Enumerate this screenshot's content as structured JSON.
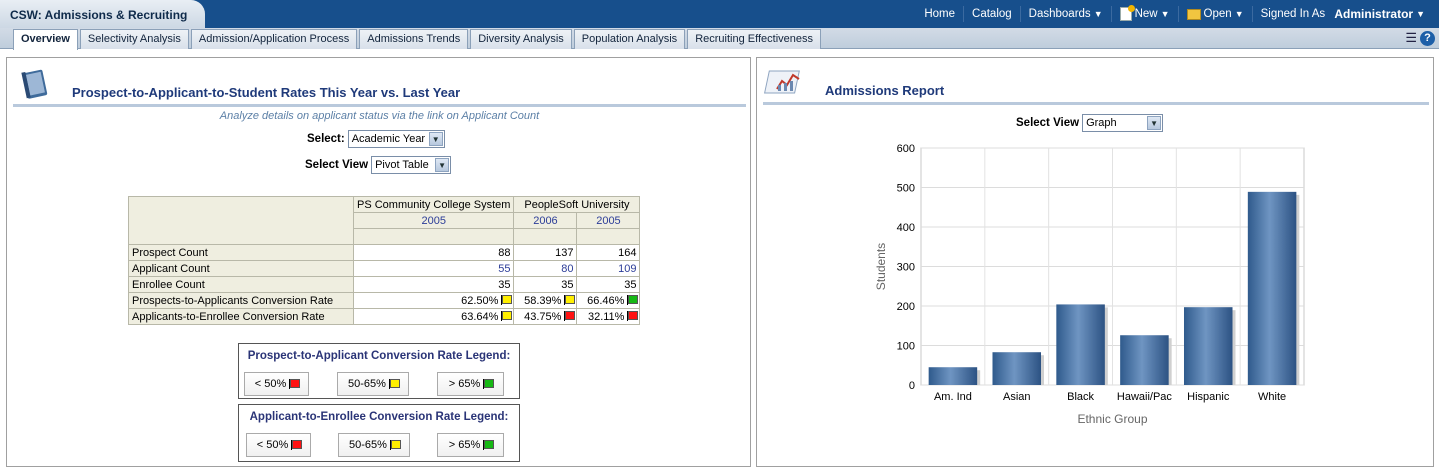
{
  "app_title": "CSW: Admissions & Recruiting",
  "topnav": {
    "home": "Home",
    "catalog": "Catalog",
    "dashboards": "Dashboards",
    "new": "New",
    "open": "Open",
    "signed_in_as": "Signed In As",
    "user": "Administrator"
  },
  "tabs": [
    {
      "label": "Overview",
      "active": true
    },
    {
      "label": "Selectivity Analysis"
    },
    {
      "label": "Admission/Application Process"
    },
    {
      "label": "Admissions Trends"
    },
    {
      "label": "Diversity Analysis"
    },
    {
      "label": "Population Analysis"
    },
    {
      "label": "Recruiting Effectiveness"
    }
  ],
  "left": {
    "title": "Prospect-to-Applicant-to-Student Rates This Year vs. Last Year",
    "note": "Analyze details on applicant status via the link on Applicant Count",
    "select_label": "Select:",
    "select_value": "Academic Year",
    "view_label": "Select View",
    "view_value": "Pivot Table",
    "table": {
      "col_groups": [
        "PS Community College System",
        "PeopleSoft University"
      ],
      "years": [
        "2005",
        "2006",
        "2005"
      ],
      "rows": [
        {
          "label": "Prospect Count",
          "values": [
            "88",
            "137",
            "164"
          ],
          "flags": [
            "",
            "",
            ""
          ],
          "link": false
        },
        {
          "label": "Applicant Count",
          "values": [
            "55",
            "80",
            "109"
          ],
          "flags": [
            "",
            "",
            ""
          ],
          "link": true
        },
        {
          "label": "Enrollee Count",
          "values": [
            "35",
            "35",
            "35"
          ],
          "flags": [
            "",
            "",
            ""
          ],
          "link": false
        },
        {
          "label": "Prospects-to-Applicants Conversion Rate",
          "values": [
            "62.50%",
            "58.39%",
            "66.46%"
          ],
          "flags": [
            "yellow",
            "yellow",
            "green"
          ],
          "link": false
        },
        {
          "label": "Applicants-to-Enrollee Conversion Rate",
          "values": [
            "63.64%",
            "43.75%",
            "32.11%"
          ],
          "flags": [
            "yellow",
            "red",
            "red"
          ],
          "link": false
        }
      ]
    },
    "legend1": {
      "title": "Prospect-to-Applicant Conversion Rate Legend:",
      "items": [
        {
          "label": "< 50%",
          "flag": "red"
        },
        {
          "label": "50-65%",
          "flag": "yellow"
        },
        {
          "label": "> 65%",
          "flag": "green"
        }
      ]
    },
    "legend2": {
      "title": "Applicant-to-Enrollee Conversion Rate Legend:",
      "items": [
        {
          "label": "< 50%",
          "flag": "red"
        },
        {
          "label": "50-65%",
          "flag": "yellow"
        },
        {
          "label": "> 65%",
          "flag": "green"
        }
      ]
    }
  },
  "right": {
    "title": "Admissions Report",
    "view_label": "Select View",
    "view_value": "Graph"
  },
  "chart_data": {
    "type": "bar",
    "categories": [
      "Am. Ind",
      "Asian",
      "Black",
      "Hawaii/Pac",
      "Hispanic",
      "White"
    ],
    "values": [
      45,
      83,
      204,
      126,
      197,
      489
    ],
    "xlabel": "Ethnic Group",
    "ylabel": "Students",
    "ylim": [
      0,
      600
    ],
    "yticks": [
      0,
      100,
      200,
      300,
      400,
      500,
      600
    ],
    "grid": true,
    "bar_color": "#3e6da3"
  }
}
